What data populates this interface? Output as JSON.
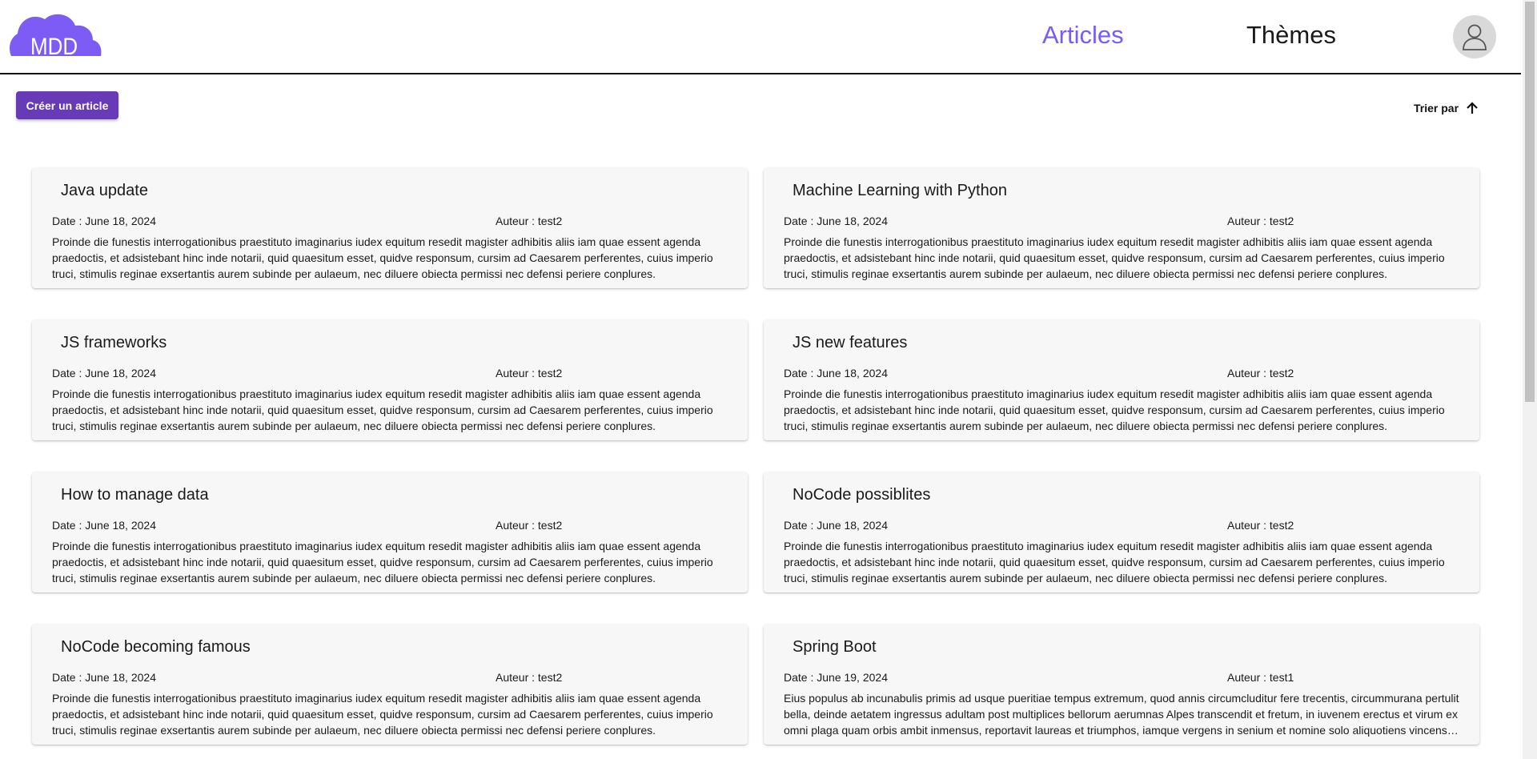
{
  "colors": {
    "accent": "#7a5af8",
    "button": "#673ab7",
    "nav_inactive": "#1a1a1a",
    "logo": "#7c5cf5"
  },
  "header": {
    "logo_text": "MDD",
    "nav": [
      {
        "label": "Articles",
        "active": true
      },
      {
        "label": "Thèmes",
        "active": false
      }
    ],
    "avatar_icon": "user-icon"
  },
  "toolbar": {
    "create_label": "Créer un article",
    "sort_label": "Trier par",
    "sort_icon": "arrow-up-icon"
  },
  "articles": [
    {
      "title": "Java update",
      "date": "Date : June 18, 2024",
      "author": "Auteur : test2",
      "content": "Proinde die funestis interrogationibus praestituto imaginarius iudex equitum resedit magister adhibitis aliis iam quae essent agenda praedoctis, et adsistebant hinc inde notarii, quid quaesitum esset, quidve responsum, cursim ad Caesarem perferentes, cuius imperio truci, stimulis reginae exsertantis aurem subinde per aulaeum, nec diluere obiecta permissi nec defensi periere conplures."
    },
    {
      "title": "Machine Learning with Python",
      "date": "Date : June 18, 2024",
      "author": "Auteur : test2",
      "content": "Proinde die funestis interrogationibus praestituto imaginarius iudex equitum resedit magister adhibitis aliis iam quae essent agenda praedoctis, et adsistebant hinc inde notarii, quid quaesitum esset, quidve responsum, cursim ad Caesarem perferentes, cuius imperio truci, stimulis reginae exsertantis aurem subinde per aulaeum, nec diluere obiecta permissi nec defensi periere conplures."
    },
    {
      "title": "JS frameworks",
      "date": "Date : June 18, 2024",
      "author": "Auteur : test2",
      "content": "Proinde die funestis interrogationibus praestituto imaginarius iudex equitum resedit magister adhibitis aliis iam quae essent agenda praedoctis, et adsistebant hinc inde notarii, quid quaesitum esset, quidve responsum, cursim ad Caesarem perferentes, cuius imperio truci, stimulis reginae exsertantis aurem subinde per aulaeum, nec diluere obiecta permissi nec defensi periere conplures."
    },
    {
      "title": "JS new features",
      "date": "Date : June 18, 2024",
      "author": "Auteur : test2",
      "content": "Proinde die funestis interrogationibus praestituto imaginarius iudex equitum resedit magister adhibitis aliis iam quae essent agenda praedoctis, et adsistebant hinc inde notarii, quid quaesitum esset, quidve responsum, cursim ad Caesarem perferentes, cuius imperio truci, stimulis reginae exsertantis aurem subinde per aulaeum, nec diluere obiecta permissi nec defensi periere conplures."
    },
    {
      "title": "How to manage data",
      "date": "Date : June 18, 2024",
      "author": "Auteur : test2",
      "content": "Proinde die funestis interrogationibus praestituto imaginarius iudex equitum resedit magister adhibitis aliis iam quae essent agenda praedoctis, et adsistebant hinc inde notarii, quid quaesitum esset, quidve responsum, cursim ad Caesarem perferentes, cuius imperio truci, stimulis reginae exsertantis aurem subinde per aulaeum, nec diluere obiecta permissi nec defensi periere conplures."
    },
    {
      "title": "NoCode possiblites",
      "date": "Date : June 18, 2024",
      "author": "Auteur : test2",
      "content": "Proinde die funestis interrogationibus praestituto imaginarius iudex equitum resedit magister adhibitis aliis iam quae essent agenda praedoctis, et adsistebant hinc inde notarii, quid quaesitum esset, quidve responsum, cursim ad Caesarem perferentes, cuius imperio truci, stimulis reginae exsertantis aurem subinde per aulaeum, nec diluere obiecta permissi nec defensi periere conplures."
    },
    {
      "title": "NoCode becoming famous",
      "date": "Date : June 18, 2024",
      "author": "Auteur : test2",
      "content": "Proinde die funestis interrogationibus praestituto imaginarius iudex equitum resedit magister adhibitis aliis iam quae essent agenda praedoctis, et adsistebant hinc inde notarii, quid quaesitum esset, quidve responsum, cursim ad Caesarem perferentes, cuius imperio truci, stimulis reginae exsertantis aurem subinde per aulaeum, nec diluere obiecta permissi nec defensi periere conplures."
    },
    {
      "title": "Spring Boot",
      "date": "Date : June 19, 2024",
      "author": "Auteur : test1",
      "content": "Eius populus ab incunabulis primis ad usque pueritiae tempus extremum, quod annis circumcluditur fere trecentis, circummurana pertulit bella, deinde aetatem ingressus adultam post multiplices bellorum aerumnas Alpes transcendit et fretum, in iuvenem erectus et virum ex omni plaga quam orbis ambit inmensus, reportavit laureas et triumphos, iamque vergens in senium et nomine solo aliquotiens vincens a..."
    }
  ]
}
